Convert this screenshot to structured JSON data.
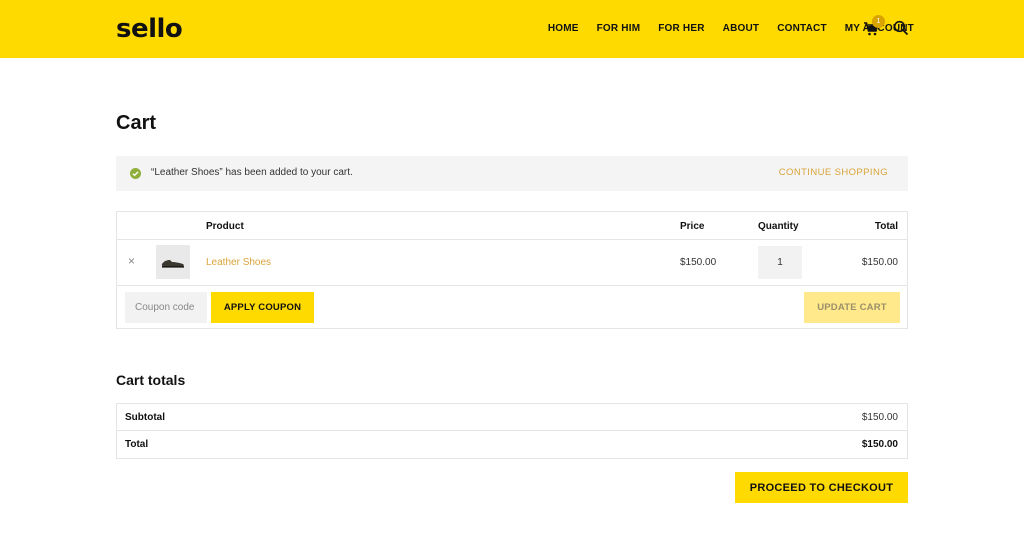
{
  "brand": {
    "logo": "sello",
    "accent": "#ffda00"
  },
  "nav": [
    "HOME",
    "FOR HIM",
    "FOR HER",
    "ABOUT",
    "CONTACT",
    "MY ACCOUNT"
  ],
  "header_icons": {
    "cart": "cart-icon",
    "search": "search-icon",
    "cart_count": "1"
  },
  "page": {
    "title": "Cart"
  },
  "notice": {
    "message": "“Leather Shoes” has been added to your cart.",
    "link": "CONTINUE SHOPPING",
    "icon": "check-circle-icon"
  },
  "cart_table": {
    "headers": {
      "product": "Product",
      "price": "Price",
      "quantity": "Quantity",
      "total": "Total"
    },
    "rows": [
      {
        "remove": "×",
        "name": "Leather Shoes",
        "price": "$150.00",
        "quantity": "1",
        "total": "$150.00"
      }
    ],
    "coupon_placeholder": "Coupon code",
    "apply_label": "APPLY COUPON",
    "update_label": "UPDATE CART"
  },
  "totals": {
    "title": "Cart totals",
    "subtotal_label": "Subtotal",
    "subtotal_value": "$150.00",
    "total_label": "Total",
    "total_value": "$150.00",
    "checkout_label": "PROCEED TO CHECKOUT"
  }
}
